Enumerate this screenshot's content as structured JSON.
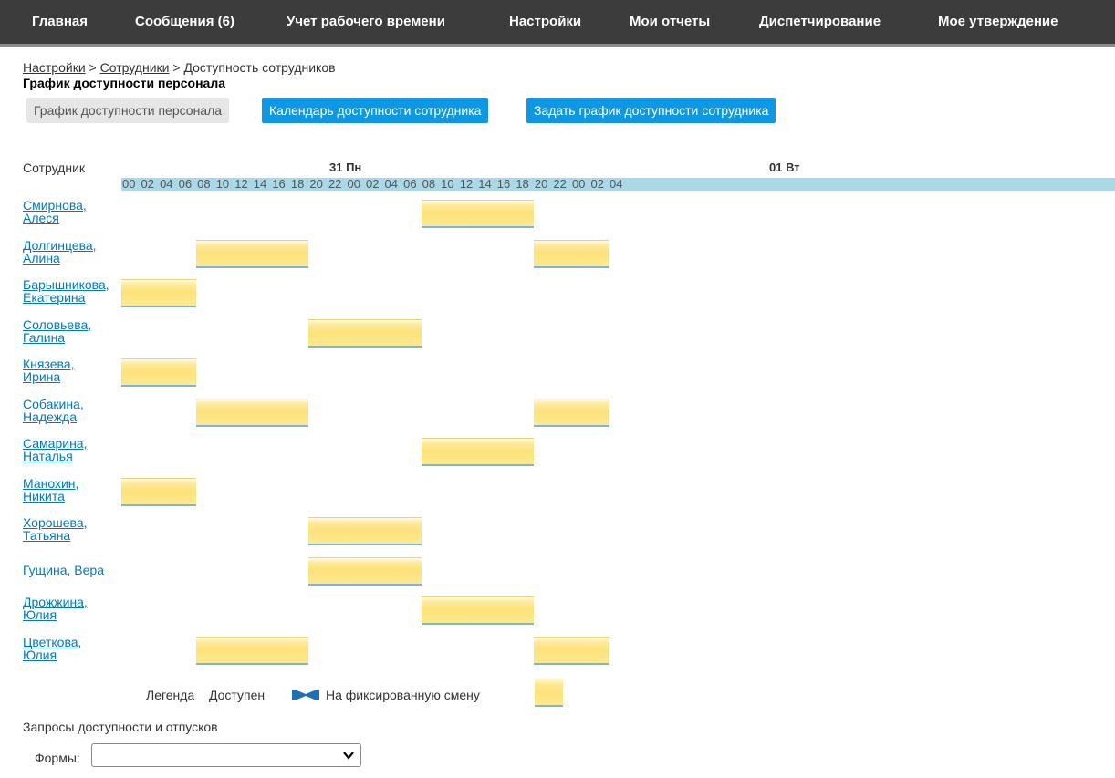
{
  "nav": [
    {
      "label": "Главная"
    },
    {
      "label": "Сообщения (6)"
    },
    {
      "label": "Учет рабочего времени"
    },
    {
      "label": "Настройки"
    },
    {
      "label": "Мои отчеты"
    },
    {
      "label": "Диспетчирование"
    },
    {
      "label": "Мое утверждение"
    }
  ],
  "breadcrumb": {
    "items": [
      "Настройки",
      "Сотрудники"
    ],
    "separator": ">",
    "current": "Доступность сотрудников"
  },
  "page_title": "График доступности персонала",
  "tabs": [
    {
      "label": "График доступности персонала",
      "active": false
    },
    {
      "label": "Календарь доступности сотрудника",
      "active": true
    },
    {
      "label": "Задать график доступности сотрудника",
      "active": true
    }
  ],
  "schedule": {
    "column_header": "Сотрудник",
    "days": [
      "31 Пн",
      "01 Вт"
    ],
    "hours": [
      "00",
      "02",
      "04",
      "06",
      "08",
      "10",
      "12",
      "14",
      "16",
      "18",
      "20",
      "22",
      "00",
      "02",
      "04",
      "06",
      "08",
      "10",
      "12",
      "14",
      "16",
      "18",
      "20",
      "22",
      "00",
      "02",
      "04"
    ],
    "employees": [
      {
        "line1": "Смирнова,",
        "line2": "Алеся",
        "shifts": [
          [
            32,
            44
          ]
        ]
      },
      {
        "line1": "Долгинцева,",
        "line2": "Алина",
        "shifts": [
          [
            8,
            20
          ],
          [
            44,
            52
          ]
        ]
      },
      {
        "line1": "Барышникова,",
        "line2": "Екатерина",
        "shifts": [
          [
            0,
            8
          ]
        ]
      },
      {
        "line1": "Соловьева,",
        "line2": "Галина",
        "shifts": [
          [
            20,
            32
          ]
        ]
      },
      {
        "line1": "Князева,",
        "line2": "Ирина",
        "shifts": [
          [
            0,
            8
          ]
        ]
      },
      {
        "line1": "Собакина,",
        "line2": "Надежда",
        "shifts": [
          [
            8,
            20
          ],
          [
            44,
            52
          ]
        ]
      },
      {
        "line1": "Самарина,",
        "line2": "Наталья",
        "shifts": [
          [
            32,
            44
          ]
        ]
      },
      {
        "line1": "Манохин,",
        "line2": "Никита",
        "shifts": [
          [
            0,
            8
          ]
        ]
      },
      {
        "line1": "Хорошева,",
        "line2": "Татьяна",
        "shifts": [
          [
            20,
            32
          ]
        ]
      },
      {
        "line1": "Гущина, Вера",
        "line2": "",
        "shifts": [
          [
            20,
            32
          ]
        ]
      },
      {
        "line1": "Дрожжина,",
        "line2": "Юлия",
        "shifts": [
          [
            32,
            44
          ]
        ]
      },
      {
        "line1": "Цветкова,",
        "line2": "Юлия",
        "shifts": [
          [
            8,
            20
          ],
          [
            44,
            52
          ]
        ]
      }
    ]
  },
  "legend": {
    "title": "Легенда",
    "available": "Доступен",
    "fixed_shift": "На фиксированную смену",
    "available_color": "#1e6fb4",
    "shift_color": "#fde27a"
  },
  "requests_title": "Запросы доступности и отпусков",
  "forms": {
    "label": "Формы:",
    "value": ""
  },
  "colors": {
    "nav_bg": "#3c3c3c",
    "accent": "#0d98e6",
    "link": "#0078c8",
    "hour_band": "#a9d8e6"
  }
}
